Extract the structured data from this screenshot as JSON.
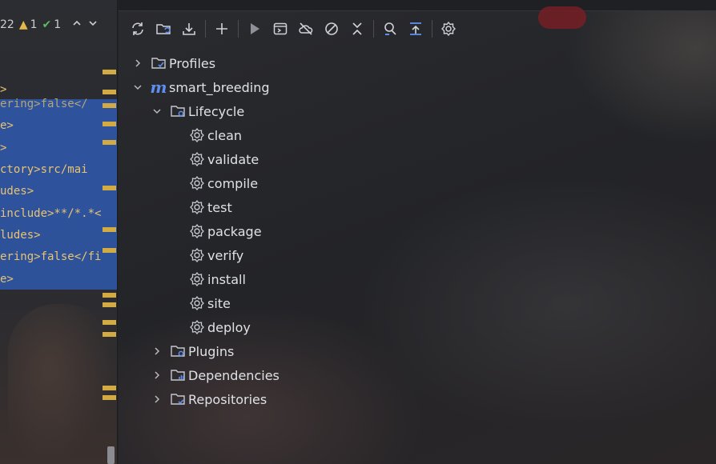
{
  "editor": {
    "toolbar": {
      "partial_count": "22",
      "warnings": "1",
      "checks": "1",
      "prev_icon": "chevron-up-icon",
      "next_icon": "chevron-down-icon"
    },
    "code_lines": [
      ">",
      "ering>false</",
      "e>",
      ">",
      "ctory>src/mai",
      "udes>",
      "include>**/*.*<",
      "ludes>",
      "ering>false</fi",
      "e>"
    ],
    "selection_color": "#2f56a4",
    "marker_color": "#d2ab45"
  },
  "maven": {
    "toolbar": [
      {
        "name": "reload-all-icon"
      },
      {
        "name": "generate-sources-icon"
      },
      {
        "name": "download-sources-icon"
      },
      {
        "name": "add-maven-project-icon"
      },
      {
        "name": "run-maven-build-icon"
      },
      {
        "name": "execute-goal-icon"
      },
      {
        "name": "toggle-offline-mode-icon"
      },
      {
        "name": "skip-tests-icon"
      },
      {
        "name": "collapse-all-icon"
      },
      {
        "name": "analyze-dependencies-icon"
      },
      {
        "name": "show-diagram-icon"
      },
      {
        "name": "settings-icon"
      }
    ],
    "tree": {
      "profiles": "Profiles",
      "project": "smart_breeding",
      "lifecycle": "Lifecycle",
      "goals": [
        "clean",
        "validate",
        "compile",
        "test",
        "package",
        "verify",
        "install",
        "site",
        "deploy"
      ],
      "plugins": "Plugins",
      "dependencies": "Dependencies",
      "repositories": "Repositories"
    },
    "accent_color": "#5f8ef0"
  }
}
